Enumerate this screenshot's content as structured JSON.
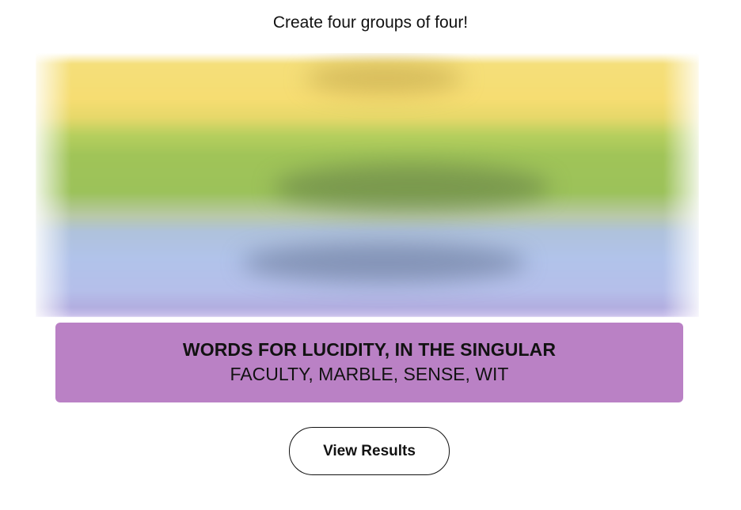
{
  "prompt": "Create four groups of four!",
  "solved_group": {
    "title": "WORDS FOR LUCIDITY, IN THE SINGULAR",
    "members": "FACULTY, MARBLE, SENSE, WIT",
    "color": "#ba81c5"
  },
  "hidden_groups": {
    "colors": [
      "#f6dd72",
      "#9cc25a",
      "#b1c3ea"
    ]
  },
  "actions": {
    "view_results_label": "View Results"
  }
}
